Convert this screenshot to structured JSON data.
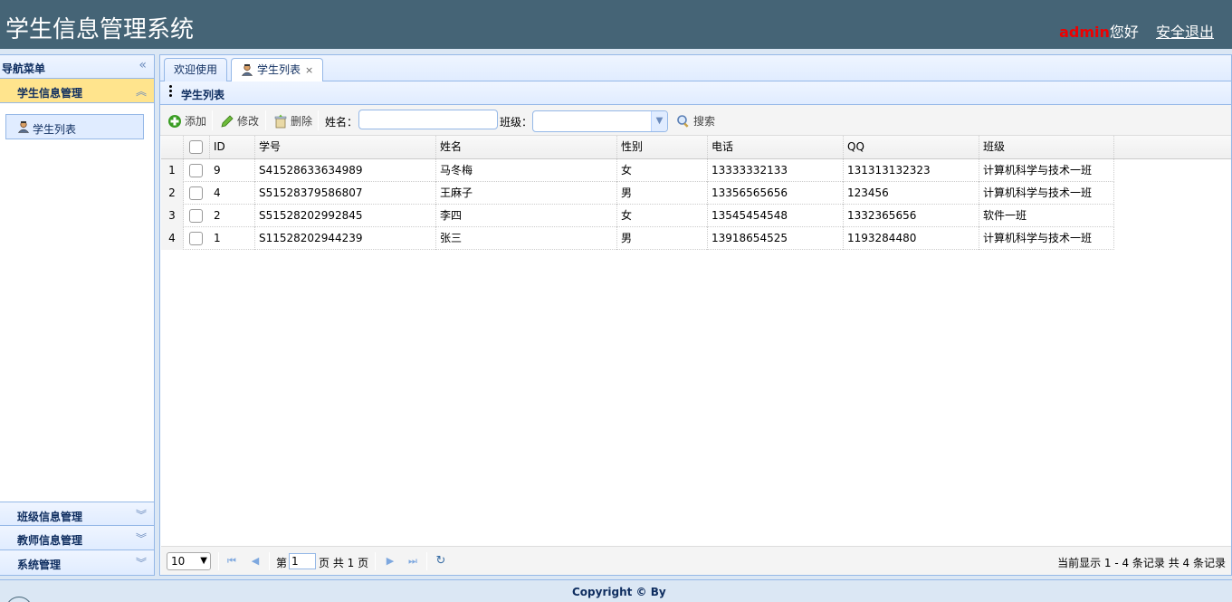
{
  "header": {
    "title": "学生信息管理系统",
    "username": "admin",
    "greeting": "您好",
    "logout": "安全退出"
  },
  "sidebar": {
    "title": "导航菜单",
    "sections": [
      {
        "label": "学生信息管理",
        "items": [
          {
            "label": "学生列表"
          }
        ]
      },
      {
        "label": "班级信息管理"
      },
      {
        "label": "教师信息管理"
      },
      {
        "label": "系统管理"
      }
    ]
  },
  "tabs": [
    {
      "label": "欢迎使用"
    },
    {
      "label": "学生列表"
    }
  ],
  "panel": {
    "title": "学生列表"
  },
  "toolbar": {
    "add": "添加",
    "edit": "修改",
    "delete": "删除",
    "name_label": "姓名：",
    "name_value": "",
    "class_label": "班级：",
    "class_value": "",
    "search": "搜索"
  },
  "grid": {
    "columns": [
      "ID",
      "学号",
      "姓名",
      "性别",
      "电话",
      "QQ",
      "班级"
    ],
    "rows": [
      {
        "num": "1",
        "id": "9",
        "sn": "S41528633634989",
        "name": "马冬梅",
        "sex": "女",
        "phone": "13333332133",
        "qq": "131313132323",
        "clazz": "计算机科学与技术一班"
      },
      {
        "num": "2",
        "id": "4",
        "sn": "S51528379586807",
        "name": "王麻子",
        "sex": "男",
        "phone": "13356565656",
        "qq": "123456",
        "clazz": "计算机科学与技术一班"
      },
      {
        "num": "3",
        "id": "2",
        "sn": "S51528202992845",
        "name": "李四",
        "sex": "女",
        "phone": "13545454548",
        "qq": "1332365656",
        "clazz": "软件一班"
      },
      {
        "num": "4",
        "id": "1",
        "sn": "S11528202944239",
        "name": "张三",
        "sex": "男",
        "phone": "13918654525",
        "qq": "1193284480",
        "clazz": "计算机科学与技术一班"
      }
    ]
  },
  "pager": {
    "page_size": "10",
    "page_prefix": "第",
    "current_page": "1",
    "page_suffix": "页 共 1 页",
    "info": "当前显示 1 - 4 条记录 共 4 条记录"
  },
  "footer": {
    "copyright": "Copyright © By"
  },
  "colors": {
    "header_bg": "#456476",
    "accent": "#95b8e7",
    "selected": "#ffe48d",
    "username": "#ee0000"
  },
  "icons": [
    "user-icon",
    "add-icon",
    "edit-icon",
    "delete-icon",
    "search-icon",
    "refresh-icon",
    "first-page-icon",
    "prev-page-icon",
    "next-page-icon",
    "last-page-icon",
    "collapse-left-icon",
    "chevron-up-icon",
    "chevron-down-icon",
    "close-icon"
  ]
}
